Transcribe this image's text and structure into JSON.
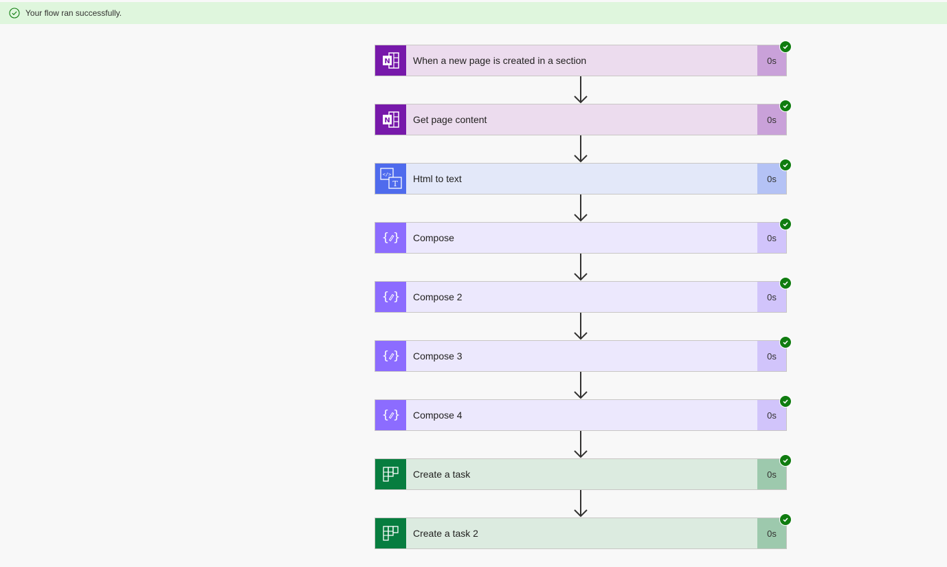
{
  "banner": {
    "message": "Your flow ran successfully.",
    "icon": "success-circle-check-icon",
    "bg_color": "#dff6dd"
  },
  "steps": [
    {
      "title": "When a new page is created in a section",
      "duration": "0s",
      "connector": "onenote",
      "status": "succeeded"
    },
    {
      "title": "Get page content",
      "duration": "0s",
      "connector": "onenote",
      "status": "succeeded"
    },
    {
      "title": "Html to text",
      "duration": "0s",
      "connector": "html-to-text",
      "status": "succeeded"
    },
    {
      "title": "Compose",
      "duration": "0s",
      "connector": "compose",
      "status": "succeeded"
    },
    {
      "title": "Compose 2",
      "duration": "0s",
      "connector": "compose",
      "status": "succeeded"
    },
    {
      "title": "Compose 3",
      "duration": "0s",
      "connector": "compose",
      "status": "succeeded"
    },
    {
      "title": "Compose 4",
      "duration": "0s",
      "connector": "compose",
      "status": "succeeded"
    },
    {
      "title": "Create a task",
      "duration": "0s",
      "connector": "planner",
      "status": "succeeded"
    },
    {
      "title": "Create a task 2",
      "duration": "0s",
      "connector": "planner",
      "status": "succeeded"
    }
  ],
  "colors": {
    "onenote": "#7719aa",
    "html_to_text": "#4f6bed",
    "compose": "#8c6cff",
    "planner": "#077d3f",
    "success": "#107c10"
  }
}
